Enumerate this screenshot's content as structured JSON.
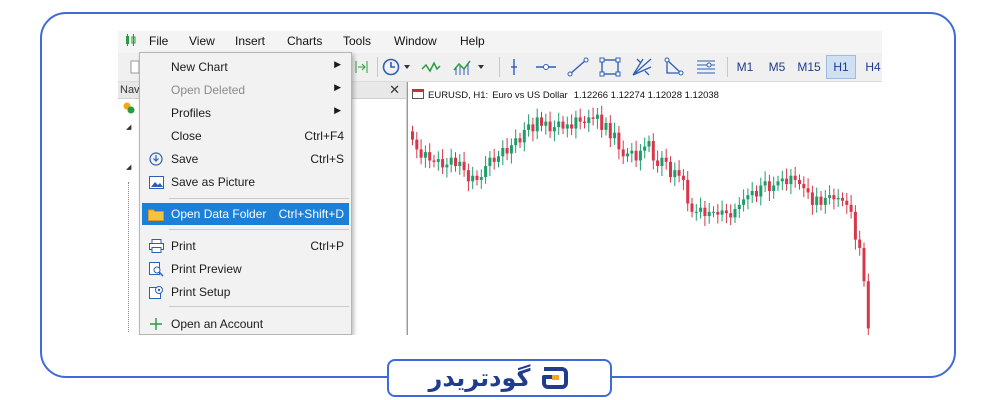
{
  "menubar": {
    "items": [
      "File",
      "View",
      "Insert",
      "Charts",
      "Tools",
      "Window",
      "Help"
    ]
  },
  "toolbar": {
    "timeframes": [
      "M1",
      "M5",
      "M15",
      "H1",
      "H4"
    ],
    "active_timeframe": "H1"
  },
  "navigator": {
    "header": "Nav"
  },
  "file_menu": {
    "items": [
      {
        "label": "New Chart",
        "shortcut": "",
        "submenu": true,
        "disabled": false,
        "icon": "none"
      },
      {
        "label": "Open Deleted",
        "shortcut": "",
        "submenu": true,
        "disabled": true,
        "icon": "none"
      },
      {
        "label": "Profiles",
        "shortcut": "",
        "submenu": true,
        "disabled": false,
        "icon": "none"
      },
      {
        "label": "Close",
        "shortcut": "Ctrl+F4",
        "submenu": false,
        "disabled": false,
        "icon": "none"
      },
      {
        "label": "Save",
        "shortcut": "Ctrl+S",
        "submenu": false,
        "disabled": false,
        "icon": "save-icon"
      },
      {
        "label": "Save as Picture",
        "shortcut": "",
        "submenu": false,
        "disabled": false,
        "icon": "picture-icon"
      },
      {
        "label": "Open Data Folder",
        "shortcut": "Ctrl+Shift+D",
        "submenu": false,
        "disabled": false,
        "icon": "folder-icon",
        "highlighted": true
      },
      {
        "label": "Print",
        "shortcut": "Ctrl+P",
        "submenu": false,
        "disabled": false,
        "icon": "printer-icon"
      },
      {
        "label": "Print Preview",
        "shortcut": "",
        "submenu": false,
        "disabled": false,
        "icon": "print-preview-icon"
      },
      {
        "label": "Print Setup",
        "shortcut": "",
        "submenu": false,
        "disabled": false,
        "icon": "print-setup-icon"
      },
      {
        "label": "Open an Account",
        "shortcut": "",
        "submenu": false,
        "disabled": false,
        "icon": "plus-icon"
      }
    ]
  },
  "chart": {
    "symbol": "EURUSD, H1:",
    "description": "Euro vs US Dollar",
    "ohlc": "1.12266 1.12274 1.12028 1.12038",
    "bull_color": "#1a9e6a",
    "bear_color": "#d9364a",
    "closes": [
      1.1365,
      1.1358,
      1.1352,
      1.1356,
      1.135,
      1.1349,
      1.1351,
      1.1345,
      1.1347,
      1.1352,
      1.1346,
      1.1349,
      1.1343,
      1.1335,
      1.1339,
      1.1336,
      1.1338,
      1.1346,
      1.1352,
      1.1349,
      1.1353,
      1.1359,
      1.1355,
      1.1361,
      1.1366,
      1.1363,
      1.1372,
      1.1376,
      1.1371,
      1.1381,
      1.1375,
      1.1378,
      1.1371,
      1.1374,
      1.1378,
      1.1373,
      1.1376,
      1.1373,
      1.1381,
      1.1378,
      1.1377,
      1.1381,
      1.138,
      1.1383,
      1.1372,
      1.1377,
      1.1366,
      1.137,
      1.1358,
      1.1353,
      1.1355,
      1.1357,
      1.135,
      1.1357,
      1.136,
      1.1364,
      1.135,
      1.1346,
      1.1352,
      1.1349,
      1.1338,
      1.1343,
      1.1339,
      1.1336,
      1.1319,
      1.1313,
      1.1313,
      1.1316,
      1.131,
      1.1313,
      1.1313,
      1.1311,
      1.1314,
      1.1312,
      1.1309,
      1.1315,
      1.1318,
      1.1322,
      1.1325,
      1.1328,
      1.1324,
      1.1332,
      1.1335,
      1.1328,
      1.1332,
      1.1335,
      1.1337,
      1.1333,
      1.1339,
      1.1336,
      1.1333,
      1.133,
      1.1327,
      1.1318,
      1.1324,
      1.1318,
      1.1323,
      1.1325,
      1.1322,
      1.1323,
      1.1321,
      1.1318,
      1.1313,
      1.1293,
      1.1287,
      1.1263,
      1.1229
    ]
  },
  "brand": {
    "name": "گودتریدر"
  }
}
